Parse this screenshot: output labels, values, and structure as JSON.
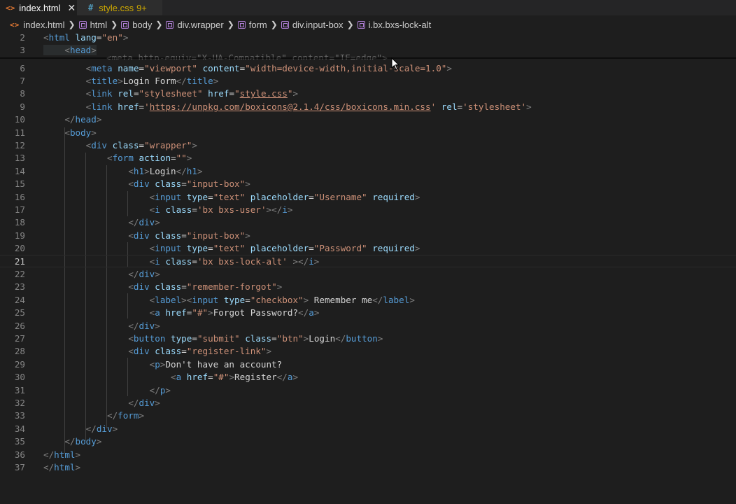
{
  "tabs": [
    {
      "label": "index.html",
      "icon": "html-file-icon",
      "active": true
    },
    {
      "label": "style.css",
      "icon": "css-file-icon",
      "problems": "9+",
      "active": false
    }
  ],
  "breadcrumb": [
    "index.html",
    "html",
    "body",
    "div.wrapper",
    "form",
    "div.input-box",
    "i.bx.bxs-lock-alt"
  ],
  "editor": {
    "current_line": 21,
    "ghost_fragment": "<meta http-equiv=\"X-UA-Compatible\" content=\"IE=edge\">",
    "line_numbers": [
      "2",
      "3",
      "6",
      "7",
      "8",
      "9",
      "10",
      "11",
      "12",
      "13",
      "14",
      "15",
      "16",
      "17",
      "18",
      "19",
      "20",
      "21",
      "22",
      "23",
      "24",
      "25",
      "26",
      "27",
      "28",
      "29",
      "30",
      "31",
      "32",
      "33",
      "34",
      "35",
      "36",
      "37"
    ]
  },
  "colors": {
    "tag": "#569cd6",
    "attribute": "#9cdcfe",
    "string": "#ce9178",
    "bracket": "#808080",
    "text": "#d4d4d4"
  }
}
